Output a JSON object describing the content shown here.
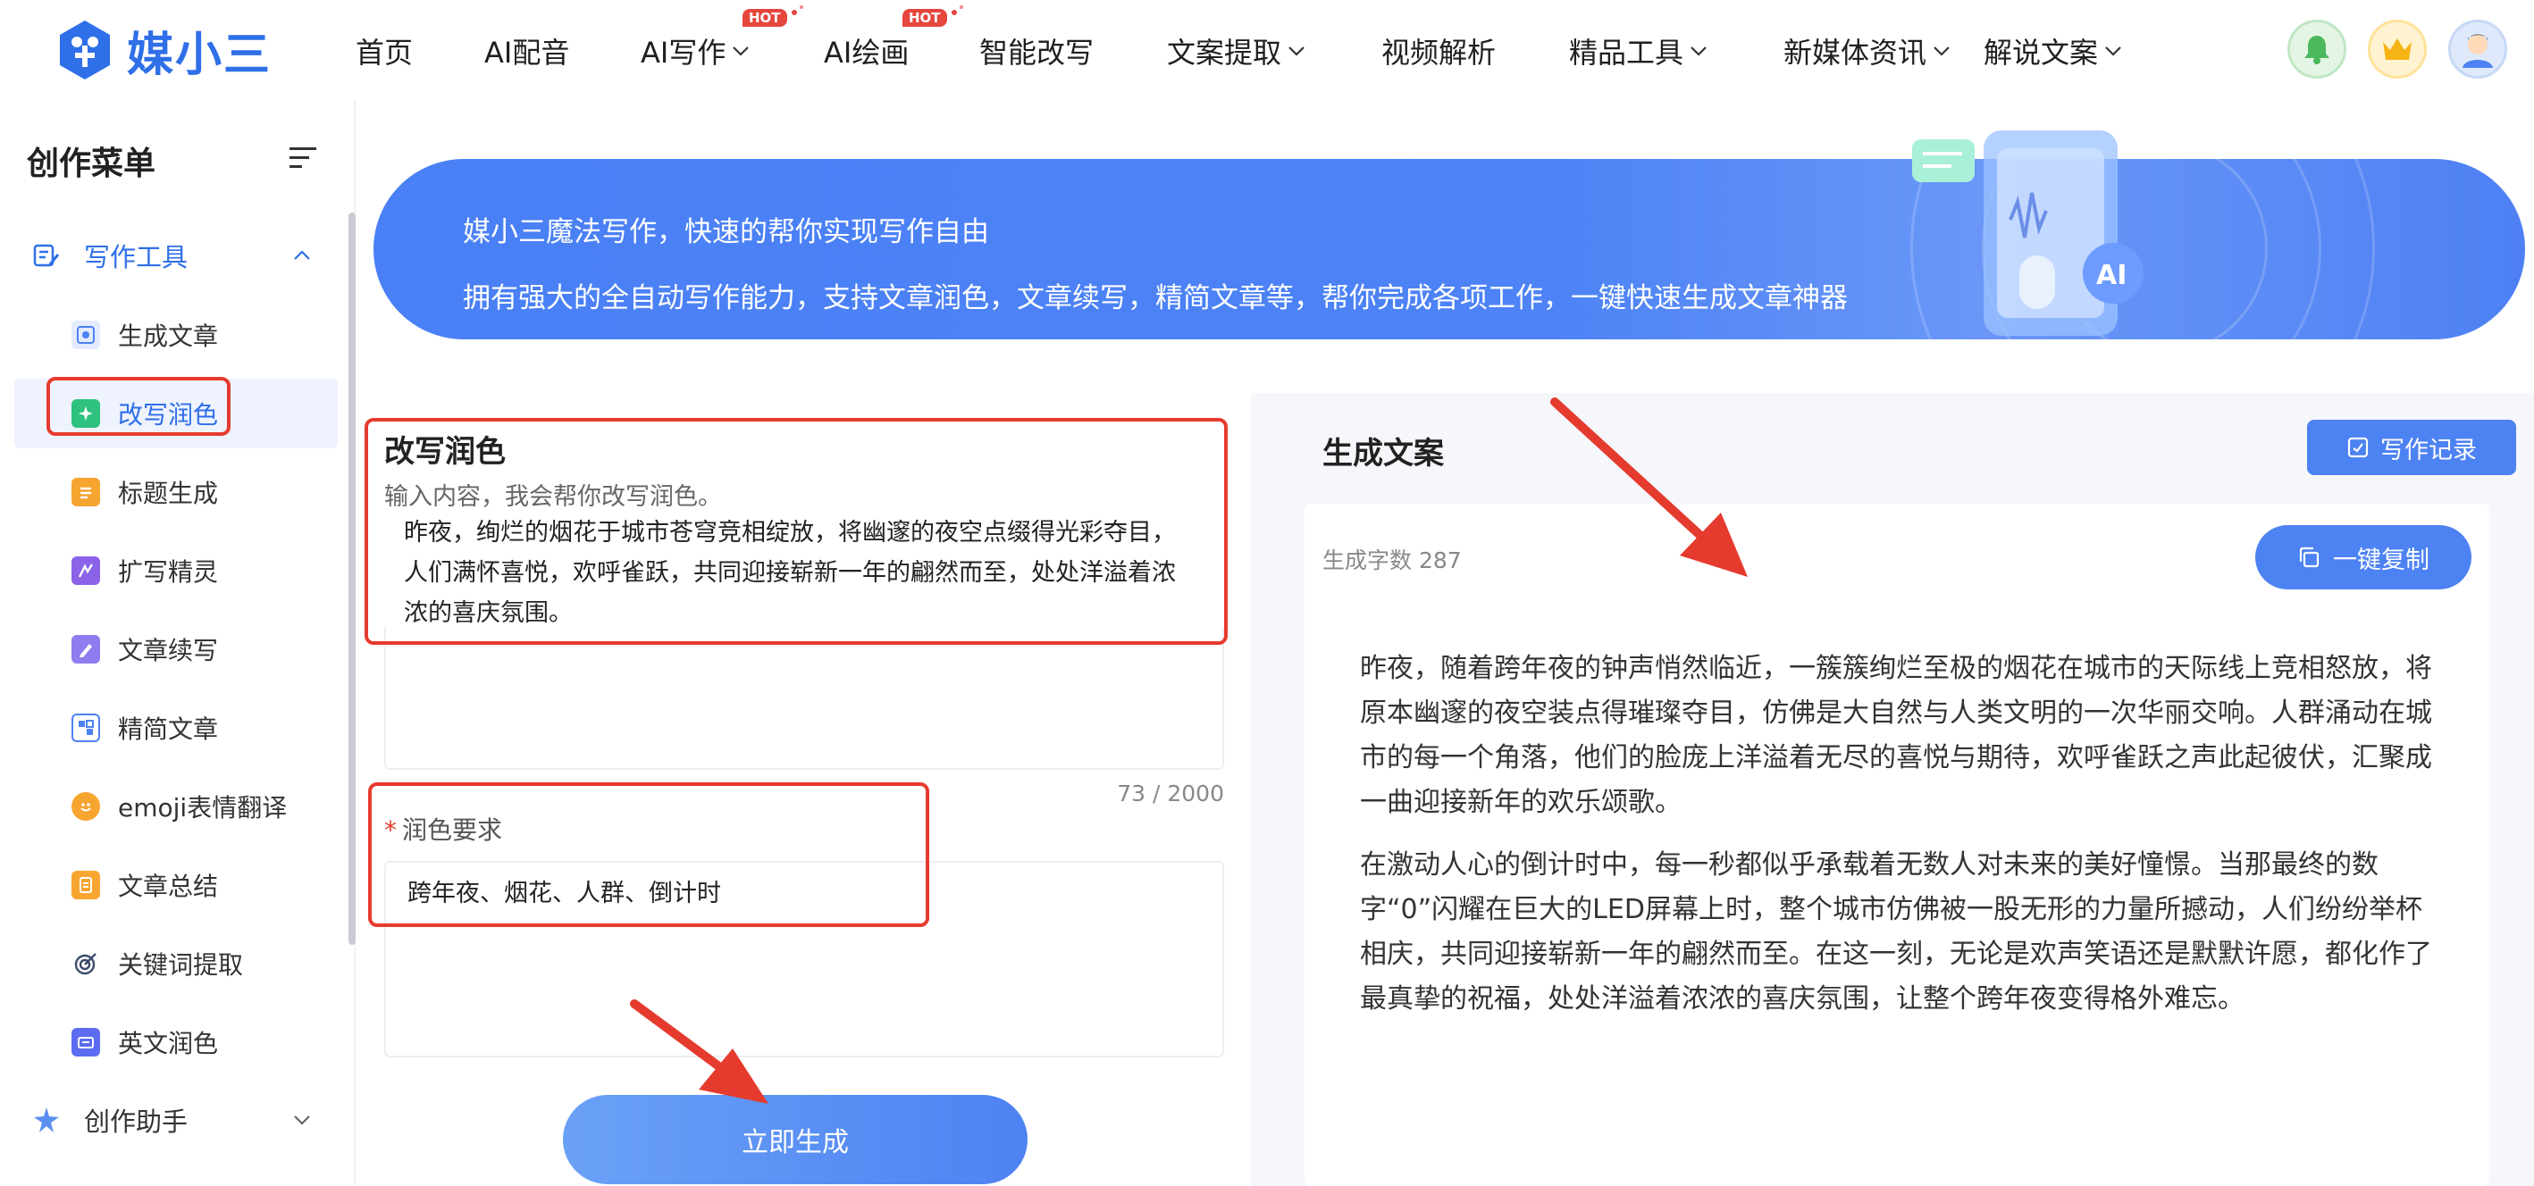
{
  "brand": {
    "name": "媒小三"
  },
  "nav": {
    "items": [
      {
        "label": "首页"
      },
      {
        "label": "AI配音"
      },
      {
        "label": "AI写作",
        "badge": "HOT"
      },
      {
        "label": "AI绘画",
        "badge": "HOT"
      },
      {
        "label": "智能改写"
      },
      {
        "label": "文案提取"
      },
      {
        "label": "视频解析"
      },
      {
        "label": "精品工具"
      },
      {
        "label": "新媒体资讯"
      },
      {
        "label": "解说文案"
      }
    ],
    "icons": [
      "bell-icon",
      "crown-icon",
      "avatar"
    ]
  },
  "sidebar": {
    "title": "创作菜单",
    "group": "写作工具",
    "items": [
      {
        "label": "生成文章",
        "icon": "article-icon"
      },
      {
        "label": "改写润色",
        "icon": "polish-icon",
        "active": true
      },
      {
        "label": "标题生成",
        "icon": "title-icon"
      },
      {
        "label": "扩写精灵",
        "icon": "expand-icon"
      },
      {
        "label": "文章续写",
        "icon": "continue-icon"
      },
      {
        "label": "精简文章",
        "icon": "simplify-icon"
      },
      {
        "label": "emoji表情翻译",
        "icon": "emoji-icon"
      },
      {
        "label": "文章总结",
        "icon": "summary-icon"
      },
      {
        "label": "关键词提取",
        "icon": "keyword-icon"
      },
      {
        "label": "英文润色",
        "icon": "english-icon"
      }
    ],
    "group2": "创作助手"
  },
  "banner": {
    "line1": "媒小三魔法写作，快速的帮你实现写作自由",
    "line2": "拥有强大的全自动写作能力，支持文章润色，文章续写，精简文章等，帮你完成各项工作，一键快速生成文章神器"
  },
  "editor": {
    "title": "改写润色",
    "hint": "输入内容，我会帮你改写润色。",
    "content": "昨夜，绚烂的烟花于城市苍穹竞相绽放，将幽邃的夜空点缀得光彩夺目，人们满怀喜悦，欢呼雀跃，共同迎接崭新一年的翩然而至，处处洋溢着浓浓的喜庆氛围。",
    "counter": "73 / 2000",
    "requirement_label": "润色要求",
    "requirement_required_mark": "*",
    "requirement_value": "跨年夜、烟花、人群、倒计时",
    "generate_button": "立即生成"
  },
  "result": {
    "title": "生成文案",
    "history_button": "写作记录",
    "word_count": "生成字数 287",
    "copy_button": "一键复制",
    "paragraphs": [
      "昨夜，随着跨年夜的钟声悄然临近，一簇簇绚烂至极的烟花在城市的天际线上竞相怒放，将原本幽邃的夜空装点得璀璨夺目，仿佛是大自然与人类文明的一次华丽交响。人群涌动在城市的每一个角落，他们的脸庞上洋溢着无尽的喜悦与期待，欢呼雀跃之声此起彼伏，汇聚成一曲迎接新年的欢乐颂歌。",
      "在激动人心的倒计时中，每一秒都似乎承载着无数人对未来的美好憧憬。当那最终的数字“0”闪耀在巨大的LED屏幕上时，整个城市仿佛被一股无形的力量所撼动，人们纷纷举杯相庆，共同迎接崭新一年的翩然而至。在这一刻，无论是欢声笑语还是默默许愿，都化作了最真挚的祝福，处处洋溢着浓浓的喜庆氛围，让整个跨年夜变得格外难忘。"
    ]
  },
  "colors": {
    "accent": "#4d82f2",
    "brand": "#2f6fe8",
    "annotation": "#e53b2e",
    "hot_badge": "#e5463d"
  }
}
